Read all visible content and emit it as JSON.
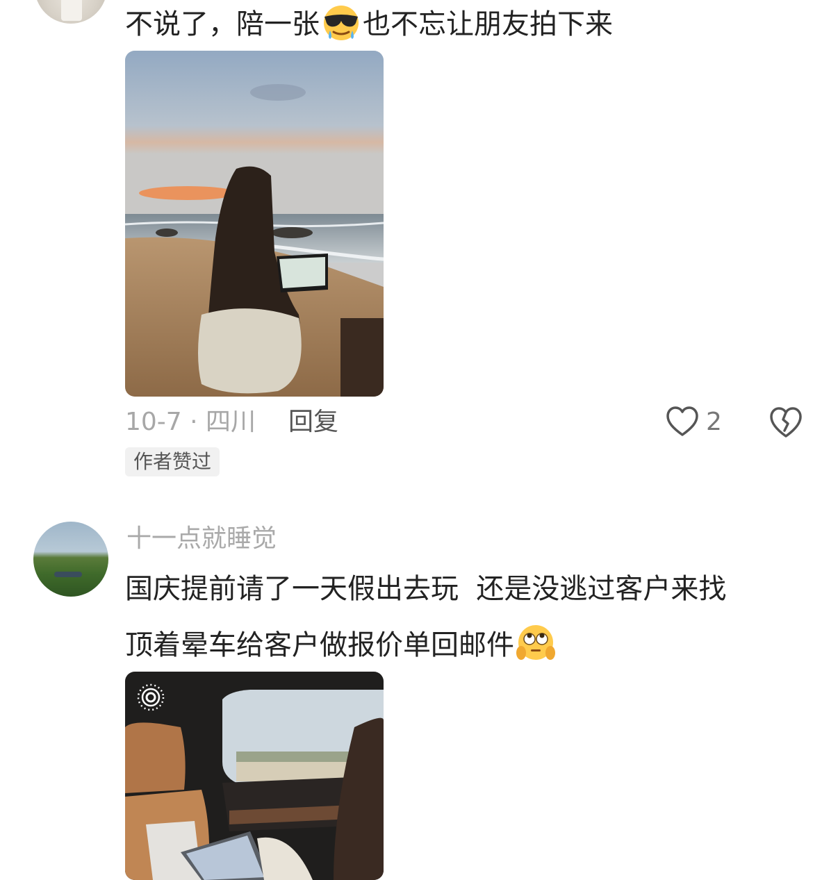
{
  "comments": [
    {
      "text_before_emoji": "不说了，陪一张",
      "emoji_name": "smiling-face-with-sunglasses-sweat-icon",
      "text_after_emoji": "也不忘让朋友拍下来",
      "photo_description_icon": "beach-laptop-photo",
      "date_location": "10-7 · 四川",
      "reply_label": "回复",
      "like_count": "2",
      "author_badge": "作者赞过"
    },
    {
      "username": "十一点就睡觉",
      "line1": "国庆提前请了一天假出去玩  还是没逃过客户来找",
      "line2": "顶着晕车给客户做报价单回邮件",
      "emoji_name": "face-with-rolling-eyes-hands-icon",
      "photo_description_icon": "car-laptop-photo"
    }
  ],
  "colors": {
    "text_primary": "#222222",
    "text_secondary": "#a7a7a7",
    "badge_bg": "#f1f1f1"
  }
}
